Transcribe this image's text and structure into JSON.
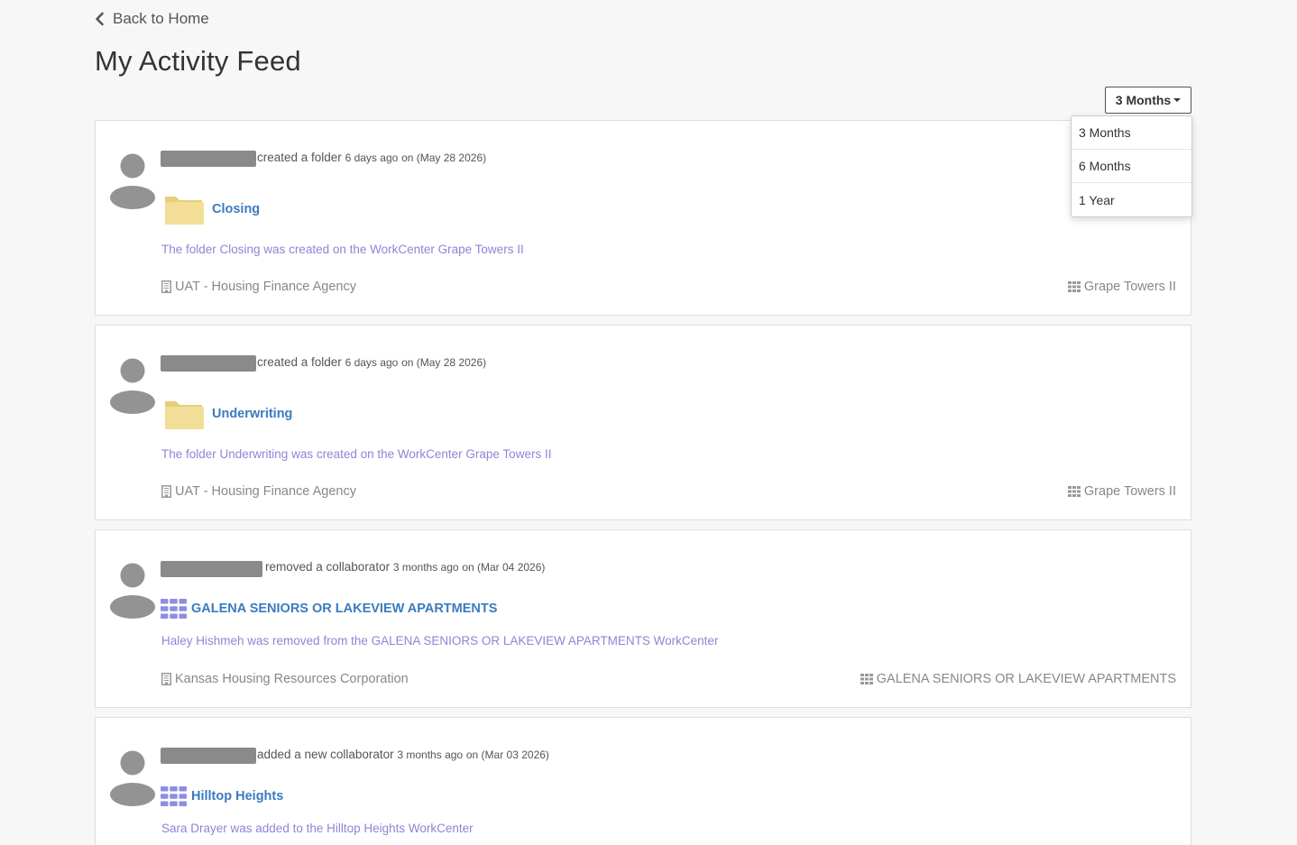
{
  "nav": {
    "back_label": "Back to Home"
  },
  "page": {
    "title": "My Activity Feed"
  },
  "filter": {
    "selected": "3 Months",
    "options": [
      "3 Months",
      "6 Months",
      "1 Year"
    ]
  },
  "colors": {
    "link_blue": "#3a7bbf",
    "description_purple": "#8e85d6",
    "workcenter_icon_purple": "#8e8ee0",
    "folder_yellow": "#f0d98c",
    "muted_text": "#888888",
    "redacted_bar": "#8a8a8a"
  },
  "activities": [
    {
      "action": "created a folder",
      "when": "6 days ago",
      "on_date": "on (May 28 2026)",
      "object_icon": "folder-icon",
      "object_name": "Closing",
      "description": "The folder Closing was created on the WorkCenter Grape Towers II",
      "organization": "UAT - Housing Finance Agency",
      "workcenter": "Grape Towers II"
    },
    {
      "action": "created a folder",
      "when": "6 days ago",
      "on_date": "on (May 28 2026)",
      "object_icon": "folder-icon",
      "object_name": "Underwriting",
      "description": "The folder Underwriting was created on the WorkCenter Grape Towers II",
      "organization": "UAT - Housing Finance Agency",
      "workcenter": "Grape Towers II"
    },
    {
      "action": "removed a collaborator",
      "when": "3 months ago",
      "on_date": "on (Mar 04 2026)",
      "object_icon": "workcenter-grid-icon",
      "object_name": "GALENA SENIORS OR LAKEVIEW APARTMENTS",
      "description": "Haley Hishmeh was removed from the GALENA SENIORS OR LAKEVIEW APARTMENTS WorkCenter",
      "organization": "Kansas Housing Resources Corporation",
      "workcenter": "GALENA SENIORS OR LAKEVIEW APARTMENTS"
    },
    {
      "action": "added a new collaborator",
      "when": "3 months ago",
      "on_date": "on (Mar 03 2026)",
      "object_icon": "workcenter-grid-icon",
      "object_name": "Hilltop Heights",
      "description": "Sara Drayer was added to the Hilltop Heights WorkCenter"
    }
  ]
}
